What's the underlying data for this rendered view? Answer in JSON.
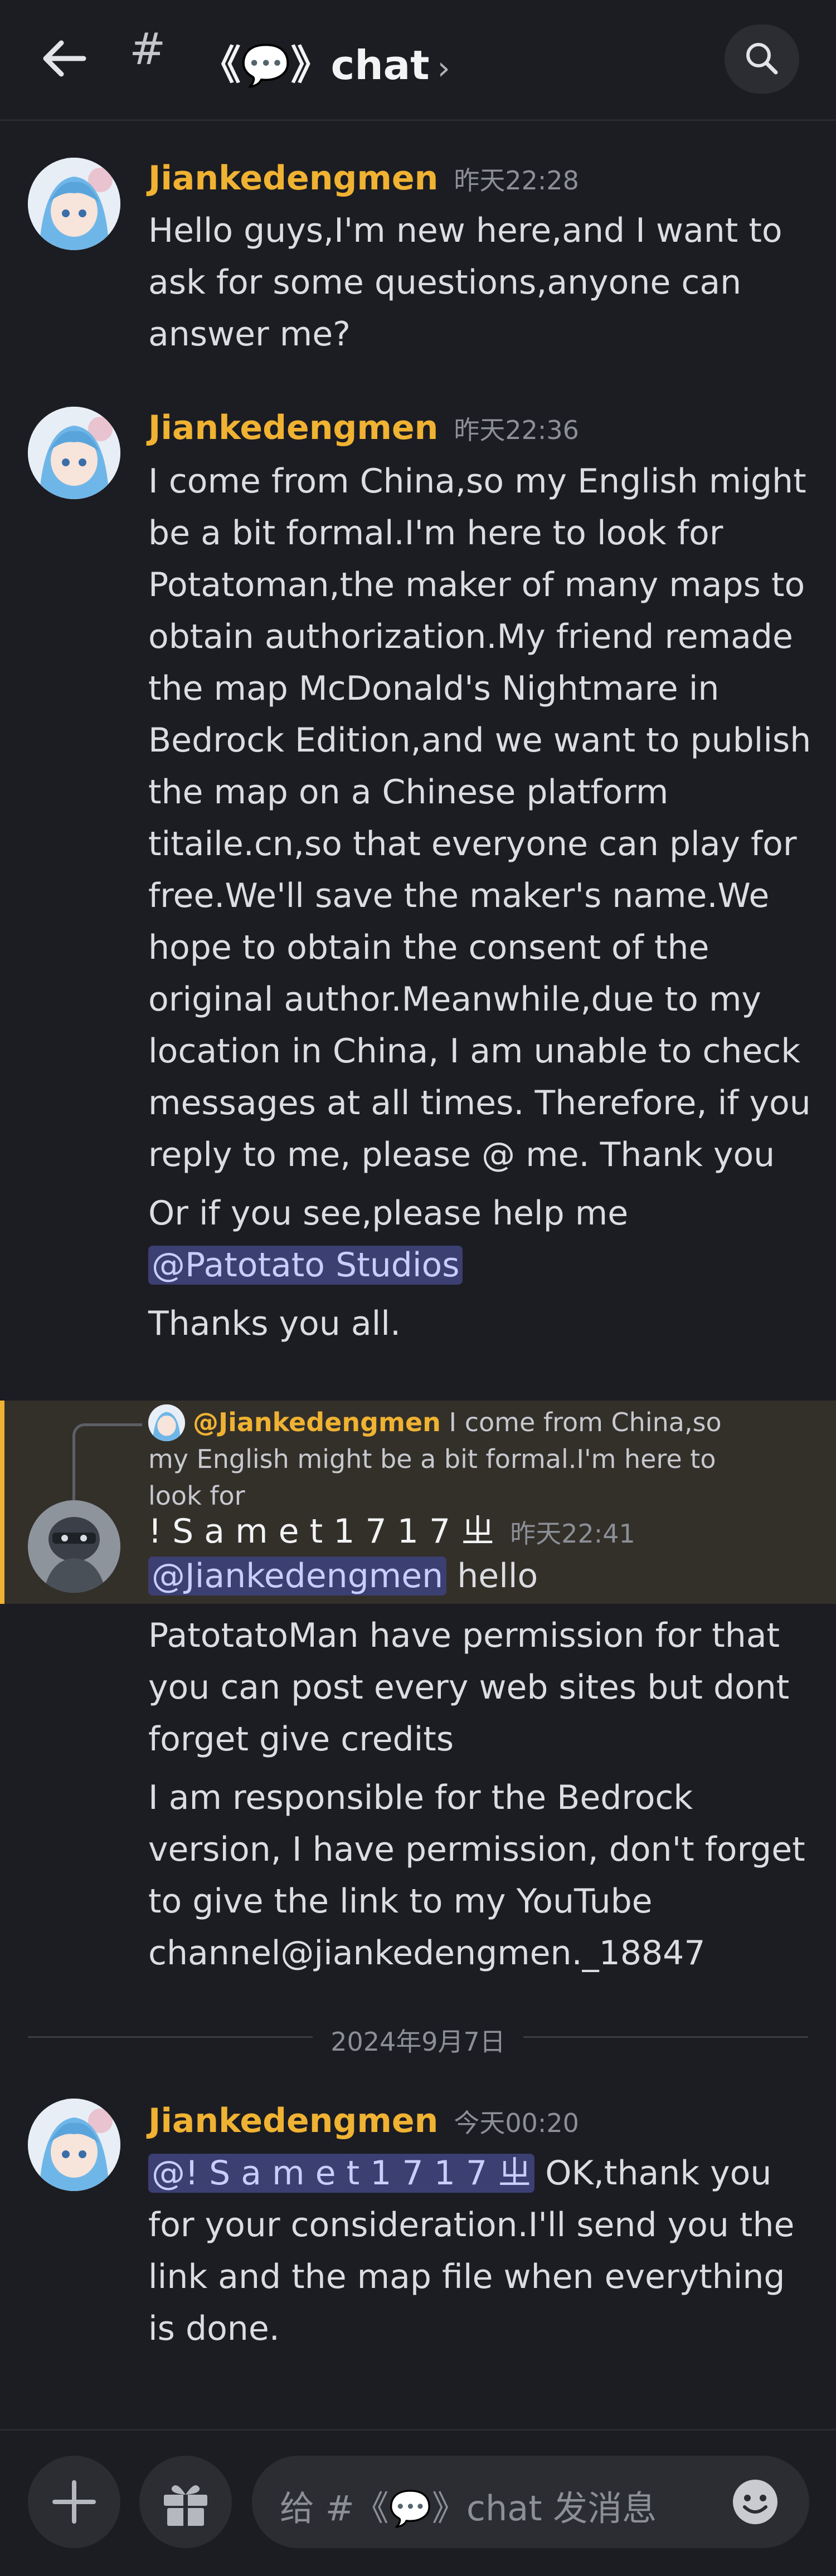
{
  "header": {
    "title": "《💬》chat",
    "hash_glyph": "#",
    "chevron": "›"
  },
  "messages": [
    {
      "author": "Jiankedengmen",
      "time": "昨天22:28",
      "paragraphs": [
        "Hello guys,I'm new here,and I want to ask for some questions,anyone can answer me?"
      ]
    },
    {
      "author": "Jiankedengmen",
      "time": "昨天22:36",
      "paragraphs": [
        "I come from China,so my English might be a bit formal.I'm here to look for Potatoman,the maker of many maps to obtain authorization.My friend remade the map McDonald's Nightmare in Bedrock Edition,and we want to publish the map on a Chinese platform titaile.cn,so that everyone can play for free.We'll save the maker's name.We hope to obtain the consent of the original author.Meanwhile,due to my location in China, I am unable to check messages at all times. Therefore, if you reply to me, please @ me. Thank you"
      ],
      "p2_text": "Or if you see,please help me ",
      "p2_mention": "@Patotato Studios",
      "p3": "Thanks you all."
    },
    {
      "reply_to": {
        "author": "@Jiankedengmen",
        "snippet": "I come from China,so my English might be a bit formal.I'm here to look for"
      },
      "author": "! S a m e t 1 7 1 7 ㄓ",
      "time": "昨天22:41",
      "mention": "@Jiankedengmen",
      "first_text": " hello",
      "paragraphs": [
        "PatotatoMan have permission for that you can post every web sites but dont forget give credits",
        "I am responsible for the Bedrock version, I have permission, don't forget to give the link to my YouTube channel@jiankedengmen._18847"
      ]
    },
    {
      "author": "Jiankedengmen",
      "time": "今天00:20",
      "mention": "@! S a m e t 1 7 1 7 ㄓ",
      "text": " OK,thank you for your consideration.I'll send you the link and the map file when everything is done."
    }
  ],
  "date_divider": "2024年9月7日",
  "composer": {
    "placeholder": "给 #《💬》chat 发消息"
  },
  "icons": [
    "back-arrow-icon",
    "hashtag-icon",
    "search-icon",
    "plus-icon",
    "gift-icon",
    "emoji-icon"
  ],
  "colors": {
    "background": "#1c1d22",
    "author": "#f0b232",
    "mention_bg": "#3b3f72",
    "highlight_bg": "#33302a"
  }
}
